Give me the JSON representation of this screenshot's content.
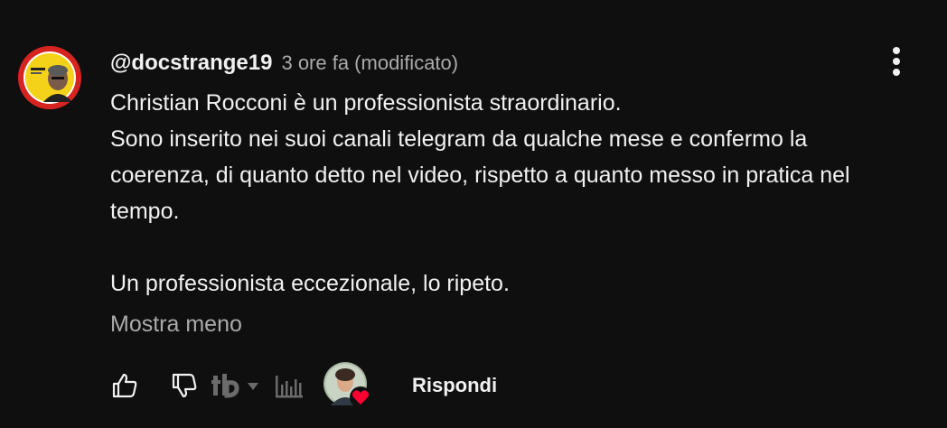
{
  "comment": {
    "author": "@docstrange19",
    "time": "3 ore fa (modificato)",
    "text": "Christian Rocconi è un professionista straordinario.\nSono inserito nei suoi canali telegram da qualche mese e confermo la coerenza, di quanto detto nel video, rispetto a quanto messo in pratica nel tempo.\n\nUn professionista eccezionale, lo ripeto.",
    "show_less": "Mostra meno"
  },
  "actions": {
    "reply_label": "Rispondi",
    "like_icon": "thumb-up-icon",
    "dislike_icon": "thumb-down-icon",
    "extension_icon": "tb-logo-icon",
    "stats_icon": "bar-chart-icon",
    "creator_heart_icon": "heart-icon"
  },
  "colors": {
    "background": "#0f0f0f",
    "text": "#f1f1f1",
    "secondary_text": "#aaaaaa",
    "heart": "#ff0033",
    "avatar_ring": "#d62420",
    "avatar_inner": "#f5d21a"
  }
}
